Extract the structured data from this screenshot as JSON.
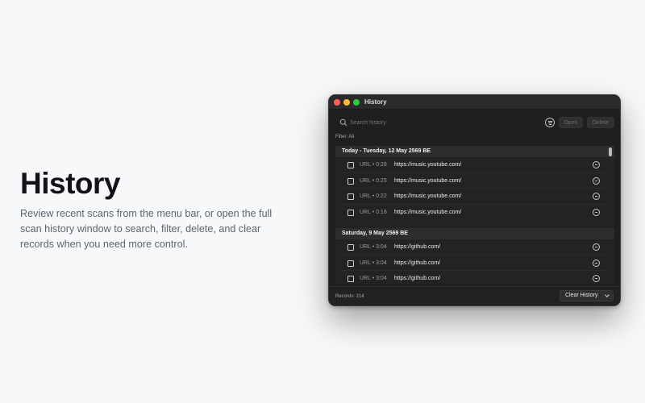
{
  "hero": {
    "title": "History",
    "description": "Review recent scans from the menu bar, or open the full scan history window to search, filter, delete, and clear records when you need more control."
  },
  "window": {
    "title": "History",
    "search": {
      "placeholder": "Search history",
      "icon": "search-icon"
    },
    "buttons": {
      "open": "Open",
      "delete": "Delete",
      "clear": "Clear History"
    },
    "filter_label": "Filter: All",
    "groups": [
      {
        "header": "Today - Tuesday, 12 May 2569 BE",
        "rows": [
          {
            "meta": "URL • 0:28",
            "url": "https://music.youtube.com/"
          },
          {
            "meta": "URL • 0:25",
            "url": "https://music.youtube.com/"
          },
          {
            "meta": "URL • 0:22",
            "url": "https://music.youtube.com/"
          },
          {
            "meta": "URL • 0:18",
            "url": "https://music.youtube.com/"
          }
        ]
      },
      {
        "header": "Saturday, 9 May 2569 BE",
        "rows": [
          {
            "meta": "URL • 3:04",
            "url": "https://github.com/"
          },
          {
            "meta": "URL • 3:04",
            "url": "https://github.com/"
          },
          {
            "meta": "URL • 3:04",
            "url": "https://github.com/"
          }
        ]
      }
    ],
    "records_label": "Records: 214"
  },
  "colors": {
    "background": "#f7f8fa",
    "window": "#1f1f1f",
    "close": "#fe5f57",
    "minimize": "#febc2e",
    "maximize": "#28c840"
  }
}
